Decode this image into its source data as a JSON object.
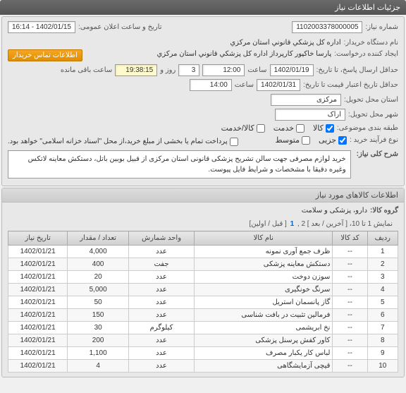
{
  "header": {
    "title": "جزئیات اطلاعات نیاز"
  },
  "form": {
    "need_number_label": "شماره نیاز:",
    "need_number": "1102003378000005",
    "announce_datetime_label": "تاریخ و ساعت اعلان عمومی:",
    "announce_datetime": "1402/01/15 - 16:14",
    "buyer_org_label": "نام دستگاه خریدار:",
    "buyer_org": "اداره کل پزشکي قانوني استان مرکزي",
    "request_creator_label": "ایجاد کننده درخواست:",
    "request_creator": "پارسا خاکپور کارپرداز اداره کل پزشکي قانوني استان مرکزي",
    "contact_btn": "اطلاعات تماس خریدار",
    "deadline_label": "حداقل ارسال پاسخ، تا تاریخ:",
    "deadline_date": "1402/01/19",
    "deadline_time_label": "ساعت",
    "deadline_time": "12:00",
    "days_label": "روز و",
    "days_value": "3",
    "remaining_label": "ساعت باقی مانده",
    "remaining_time": "19:38:15",
    "validity_label": "حداقل تاریخ اعتبار قیمت تا تاریخ:",
    "validity_date": "1402/01/31",
    "validity_time_label": "ساعت",
    "validity_time": "14:00",
    "province_label": "استان محل تحویل:",
    "province": "مرکزی",
    "city_label": "شهر محل تحویل:",
    "city": "اراک",
    "category_label": "طبقه بندی موضوعی:",
    "goods_label": "کالا",
    "service_label": "خدمت",
    "goods_service_label": "کالا/خدمت",
    "purchase_type_label": "نوع فرآیند خرید :",
    "partial_label": "جزیی",
    "medium_label": "متوسط",
    "payment_note": "پرداخت تمام یا بخشی از مبلغ خرید،از محل \"اسناد خزانه اسلامی\" خواهد بود.",
    "summary_label": "شرح کلی نیاز:",
    "summary": "خرید لوازم مصرفی جهت سالن تشریح پزشکی قانونی استان مرکزی از قبیل بوبین باتل، دستکش معاینه لاتکس وغیره دقیقا با مشخصات و شرایط فایل پیوست."
  },
  "items_section": {
    "title": "اطلاعات کالاهای مورد نیاز",
    "group_label": "گروه کالا:",
    "group": "دارو، پزشکی و سلامت",
    "pagination_text": "نمایش 1 تا 10، [ آخرین / بعد ] 2 ,",
    "pagination_current": "1",
    "pagination_suffix": "[ قبل / اولین]"
  },
  "table": {
    "headers": {
      "row": "ردیف",
      "code": "کد کالا",
      "name": "نام کالا",
      "unit": "واحد شمارش",
      "qty": "تعداد / مقدار",
      "date": "تاریخ نیاز"
    },
    "rows": [
      {
        "num": "1",
        "code": "--",
        "name": "ظرف جمع آوری نمونه",
        "unit": "عدد",
        "qty": "4,000",
        "date": "1402/01/21"
      },
      {
        "num": "2",
        "code": "--",
        "name": "دستکش معاینه پزشکی",
        "unit": "جفت",
        "qty": "400",
        "date": "1402/01/21"
      },
      {
        "num": "3",
        "code": "--",
        "name": "سوزن دوخت",
        "unit": "عدد",
        "qty": "20",
        "date": "1402/01/21"
      },
      {
        "num": "4",
        "code": "--",
        "name": "سرنگ خونگیری",
        "unit": "عدد",
        "qty": "5,000",
        "date": "1402/01/21"
      },
      {
        "num": "5",
        "code": "--",
        "name": "گاز پانسمان استریل",
        "unit": "عدد",
        "qty": "50",
        "date": "1402/01/21"
      },
      {
        "num": "6",
        "code": "--",
        "name": "فرمالین تثبیت در بافت شناسی",
        "unit": "عدد",
        "qty": "150",
        "date": "1402/01/21"
      },
      {
        "num": "7",
        "code": "--",
        "name": "نخ ابریشمی",
        "unit": "کیلوگرم",
        "qty": "30",
        "date": "1402/01/21"
      },
      {
        "num": "8",
        "code": "--",
        "name": "کاور کفش پرسنل پزشکی",
        "unit": "عدد",
        "qty": "200",
        "date": "1402/01/21"
      },
      {
        "num": "9",
        "code": "--",
        "name": "لباس کار یکبار مصرف",
        "unit": "عدد",
        "qty": "1,100",
        "date": "1402/01/21"
      },
      {
        "num": "10",
        "code": "--",
        "name": "قیچی آزمایشگاهی",
        "unit": "عدد",
        "qty": "4",
        "date": "1402/01/21"
      }
    ]
  }
}
